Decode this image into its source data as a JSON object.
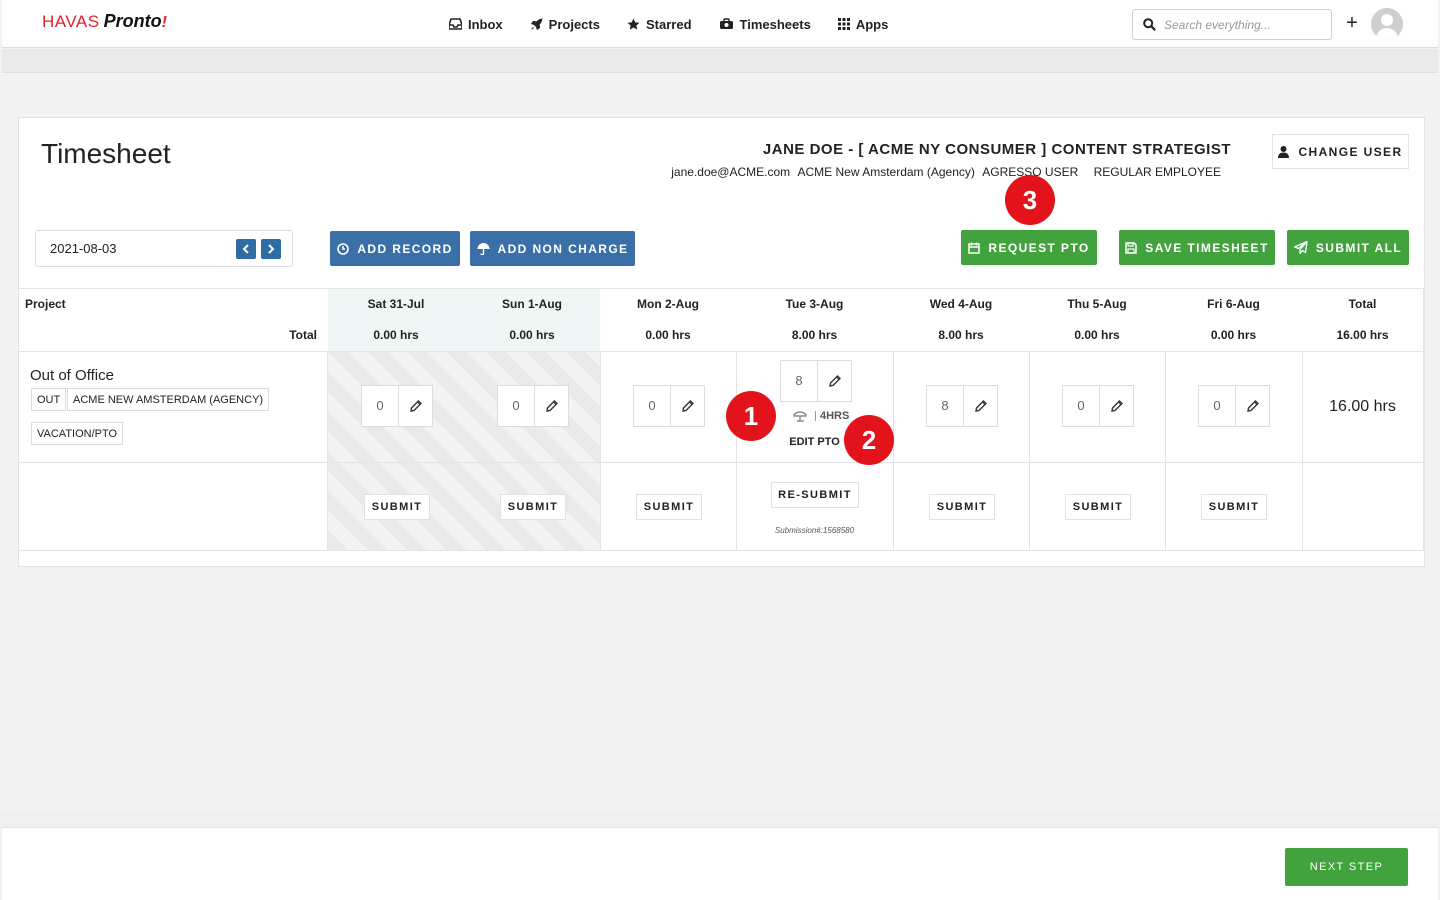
{
  "brand": {
    "name_part1": "HAVAS",
    "name_part2": "Pronto",
    "name_mark": "!"
  },
  "nav": [
    {
      "label": "Inbox",
      "icon": "inbox-icon"
    },
    {
      "label": "Projects",
      "icon": "rocket-icon"
    },
    {
      "label": "Starred",
      "icon": "star-icon"
    },
    {
      "label": "Timesheets",
      "icon": "timesheet-icon"
    },
    {
      "label": "Apps",
      "icon": "apps-grid-icon"
    }
  ],
  "search": {
    "placeholder": "Search everything..."
  },
  "page": {
    "title": "Timesheet"
  },
  "user": {
    "name": "JANE DOE - [ ACME NY CONSUMER ] CONTENT STRATEGIST",
    "email": "jane.doe@ACME.com",
    "agency": "ACME New Amsterdam (Agency)",
    "role": "AGRESSO USER",
    "type": "REGULAR EMPLOYEE",
    "change_user_label": "CHANGE USER"
  },
  "date_picker": {
    "value": "2021-08-03"
  },
  "actions": {
    "add_record": "ADD RECORD",
    "add_non_charge": "ADD NON CHARGE",
    "request_pto": "REQUEST PTO",
    "save_timesheet": "SAVE TIMESHEET",
    "submit_all": "SUBMIT ALL"
  },
  "table": {
    "project_header": "Project",
    "total_label": "Total",
    "total_header": "Total",
    "grand_total": "16.00 hrs",
    "days": [
      {
        "label": "Sat 31-Jul",
        "total": "0.00 hrs",
        "entry": "0",
        "action": "SUBMIT",
        "weekend": true
      },
      {
        "label": "Sun 1-Aug",
        "total": "0.00 hrs",
        "entry": "0",
        "action": "SUBMIT",
        "weekend": true
      },
      {
        "label": "Mon 2-Aug",
        "total": "0.00 hrs",
        "entry": "0",
        "action": "SUBMIT",
        "weekend": false
      },
      {
        "label": "Tue 3-Aug",
        "total": "8.00 hrs",
        "entry": "8",
        "action": "RE-SUBMIT",
        "weekend": false
      },
      {
        "label": "Wed 4-Aug",
        "total": "8.00 hrs",
        "entry": "8",
        "action": "SUBMIT",
        "weekend": false
      },
      {
        "label": "Thu 5-Aug",
        "total": "0.00 hrs",
        "entry": "0",
        "action": "SUBMIT",
        "weekend": false
      },
      {
        "label": "Fri 6-Aug",
        "total": "0.00 hrs",
        "entry": "0",
        "action": "SUBMIT",
        "weekend": false
      }
    ],
    "row": {
      "project_name": "Out of Office",
      "tags": [
        "OUT",
        "ACME NEW AMSTERDAM (AGENCY)",
        "VACATION/PTO"
      ],
      "row_total": "16.00 hrs",
      "pto_hours": "4HRS",
      "edit_pto": "EDIT PTO",
      "submission": "Submission#:1568580"
    }
  },
  "markers": [
    "1",
    "2",
    "3"
  ],
  "footer": {
    "next_step": "NEXT STEP"
  },
  "colors": {
    "brand_red": "#e3222b",
    "primary_blue": "#3a6fa8",
    "success_green": "#42a33e",
    "marker_red": "#e3131b"
  }
}
